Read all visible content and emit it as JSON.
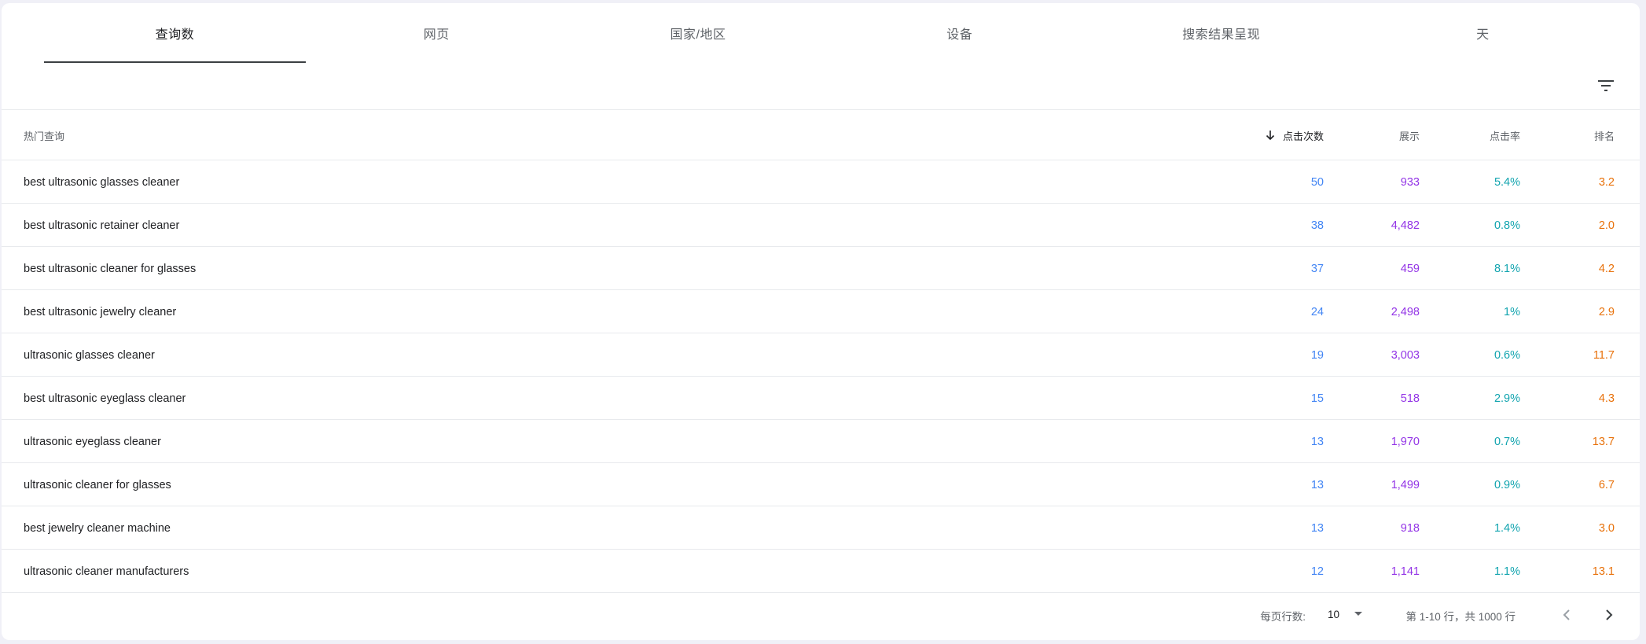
{
  "tabs": [
    {
      "label": "查询数",
      "active": true
    },
    {
      "label": "网页",
      "active": false
    },
    {
      "label": "国家/地区",
      "active": false
    },
    {
      "label": "设备",
      "active": false
    },
    {
      "label": "搜索结果呈现",
      "active": false
    },
    {
      "label": "天",
      "active": false
    }
  ],
  "toolbar": {
    "filter_icon": "filter-icon"
  },
  "table": {
    "headers": {
      "query": "热门查询",
      "clicks": "点击次数",
      "impressions": "展示",
      "ctr": "点击率",
      "position": "排名"
    },
    "sort_icon": "arrow-down-icon",
    "rows": [
      {
        "query": "best ultrasonic glasses cleaner",
        "clicks": "50",
        "impressions": "933",
        "ctr": "5.4%",
        "position": "3.2"
      },
      {
        "query": "best ultrasonic retainer cleaner",
        "clicks": "38",
        "impressions": "4,482",
        "ctr": "0.8%",
        "position": "2.0"
      },
      {
        "query": "best ultrasonic cleaner for glasses",
        "clicks": "37",
        "impressions": "459",
        "ctr": "8.1%",
        "position": "4.2"
      },
      {
        "query": "best ultrasonic jewelry cleaner",
        "clicks": "24",
        "impressions": "2,498",
        "ctr": "1%",
        "position": "2.9"
      },
      {
        "query": "ultrasonic glasses cleaner",
        "clicks": "19",
        "impressions": "3,003",
        "ctr": "0.6%",
        "position": "11.7"
      },
      {
        "query": "best ultrasonic eyeglass cleaner",
        "clicks": "15",
        "impressions": "518",
        "ctr": "2.9%",
        "position": "4.3"
      },
      {
        "query": "ultrasonic eyeglass cleaner",
        "clicks": "13",
        "impressions": "1,970",
        "ctr": "0.7%",
        "position": "13.7"
      },
      {
        "query": "ultrasonic cleaner for glasses",
        "clicks": "13",
        "impressions": "1,499",
        "ctr": "0.9%",
        "position": "6.7"
      },
      {
        "query": "best jewelry cleaner machine",
        "clicks": "13",
        "impressions": "918",
        "ctr": "1.4%",
        "position": "3.0"
      },
      {
        "query": "ultrasonic cleaner manufacturers",
        "clicks": "12",
        "impressions": "1,141",
        "ctr": "1.1%",
        "position": "13.1"
      }
    ]
  },
  "colors": {
    "clicks": "#4285f4",
    "impressions": "#9334e6",
    "ctr": "#12a4af",
    "position": "#e8710a"
  },
  "footer": {
    "rows_per_page_label": "每页行数:",
    "rows_per_page_value": "10",
    "range_text": "第 1-10 行，共 1000 行",
    "prev_icon": "chevron-left-icon",
    "next_icon": "chevron-right-icon"
  }
}
